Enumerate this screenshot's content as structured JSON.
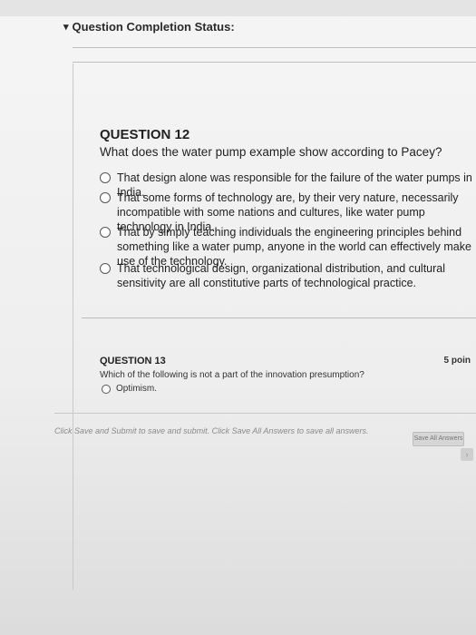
{
  "status": {
    "title": "Question Completion Status:"
  },
  "q12": {
    "number": "QUESTION 12",
    "text": "What does the water pump example show according to Pacey?",
    "options": [
      "That design alone was responsible for the failure of the water pumps in India.",
      "That some forms of technology are, by their very nature, necessarily incompatible with some nations and cultures, like water pump technology in India.",
      "That by simply teaching individuals the engineering principles behind something like a water pump, anyone in the world can effectively make use of the technology.",
      "That technological design, organizational distribution, and cultural sensitivity are all constitutive parts of technological practice."
    ]
  },
  "q13": {
    "number": "QUESTION 13",
    "points": "5 poin",
    "text": "Which of the following is not a part of the innovation presumption?",
    "option": "Optimism."
  },
  "footer": {
    "text": "Click Save and Submit to save and submit. Click Save All Answers to save all answers.",
    "save_all": "Save All Answers"
  }
}
